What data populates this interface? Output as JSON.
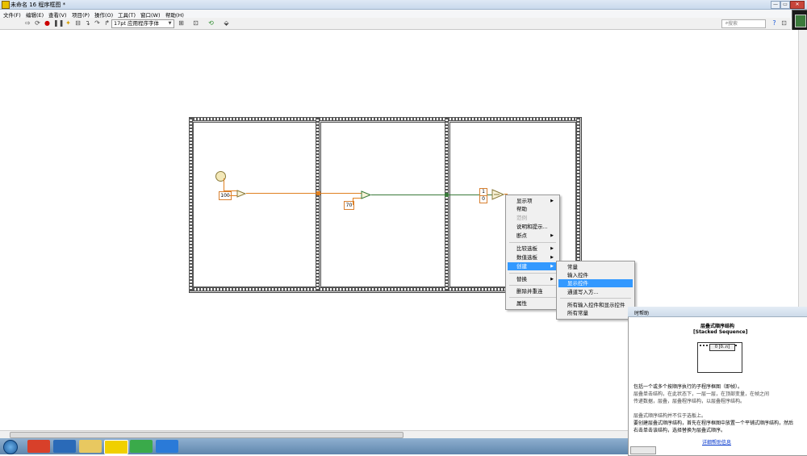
{
  "window": {
    "title": "未命名 16 程序框图 *",
    "buttons": [
      "—",
      "▭",
      "✕"
    ]
  },
  "menu": {
    "items": [
      "文件(F)",
      "编辑(E)",
      "查看(V)",
      "项目(P)",
      "操作(O)",
      "工具(T)",
      "窗口(W)",
      "帮助(H)"
    ]
  },
  "toolbar": {
    "font_select": "17pt 应用程序字体",
    "search_placeholder": "搜索"
  },
  "diagram": {
    "constants": [
      "100",
      "70",
      "1",
      "0"
    ]
  },
  "context_menu": {
    "items": [
      {
        "label": "显示项",
        "submenu": true,
        "disabled": false
      },
      {
        "label": "帮助",
        "submenu": false,
        "disabled": false
      },
      {
        "label": "范例",
        "submenu": false,
        "disabled": true
      },
      {
        "label": "说明和提示...",
        "submenu": false,
        "disabled": false
      },
      {
        "label": "断点",
        "submenu": true,
        "disabled": false
      },
      {
        "label": "比较选板",
        "submenu": true,
        "disabled": false
      },
      {
        "label": "数值选板",
        "submenu": true,
        "disabled": false
      },
      {
        "label": "创建",
        "submenu": true,
        "disabled": false,
        "selected": true
      },
      {
        "label": "替换",
        "submenu": true,
        "disabled": false
      },
      {
        "label": "删除并重连",
        "submenu": false,
        "disabled": false
      },
      {
        "label": "属性",
        "submenu": false,
        "disabled": false
      }
    ]
  },
  "create_submenu": {
    "items": [
      {
        "label": "常量",
        "selected": false
      },
      {
        "label": "输入控件",
        "selected": false
      },
      {
        "label": "显示控件",
        "selected": true
      },
      {
        "label": "通道写入方...",
        "selected": false
      },
      {
        "label": "所有输入控件和显示控件",
        "selected": false
      },
      {
        "label": "所有常量",
        "selected": false
      }
    ]
  },
  "help": {
    "bar_title": "时帮助",
    "heading": "层叠式顺序结构",
    "subheading": "[Stacked Sequence]",
    "icon_label": "0 [0..n]",
    "lines": [
      "包括一个或多个按顺序执行的子程序框图（即帧）。",
      "层叠单击结构，在此状态下，一层一层，在顶部变量，在帧之间",
      "传递数据，层叠，层叠程序结构，以层叠程序结构。",
      "层叠式顺序结构并不位于选板上。",
      "要创建层叠式顺序结构，首先在程序框图中放置一个平铺式顺序结构，然后",
      "右击单击该结构，选择替换为层叠式顺序。"
    ],
    "link": "详细帮助信息"
  },
  "colors": {
    "wire_numeric": "#e08020",
    "wire_boolean": "#3a7a3a",
    "selection": "#3399ff"
  }
}
